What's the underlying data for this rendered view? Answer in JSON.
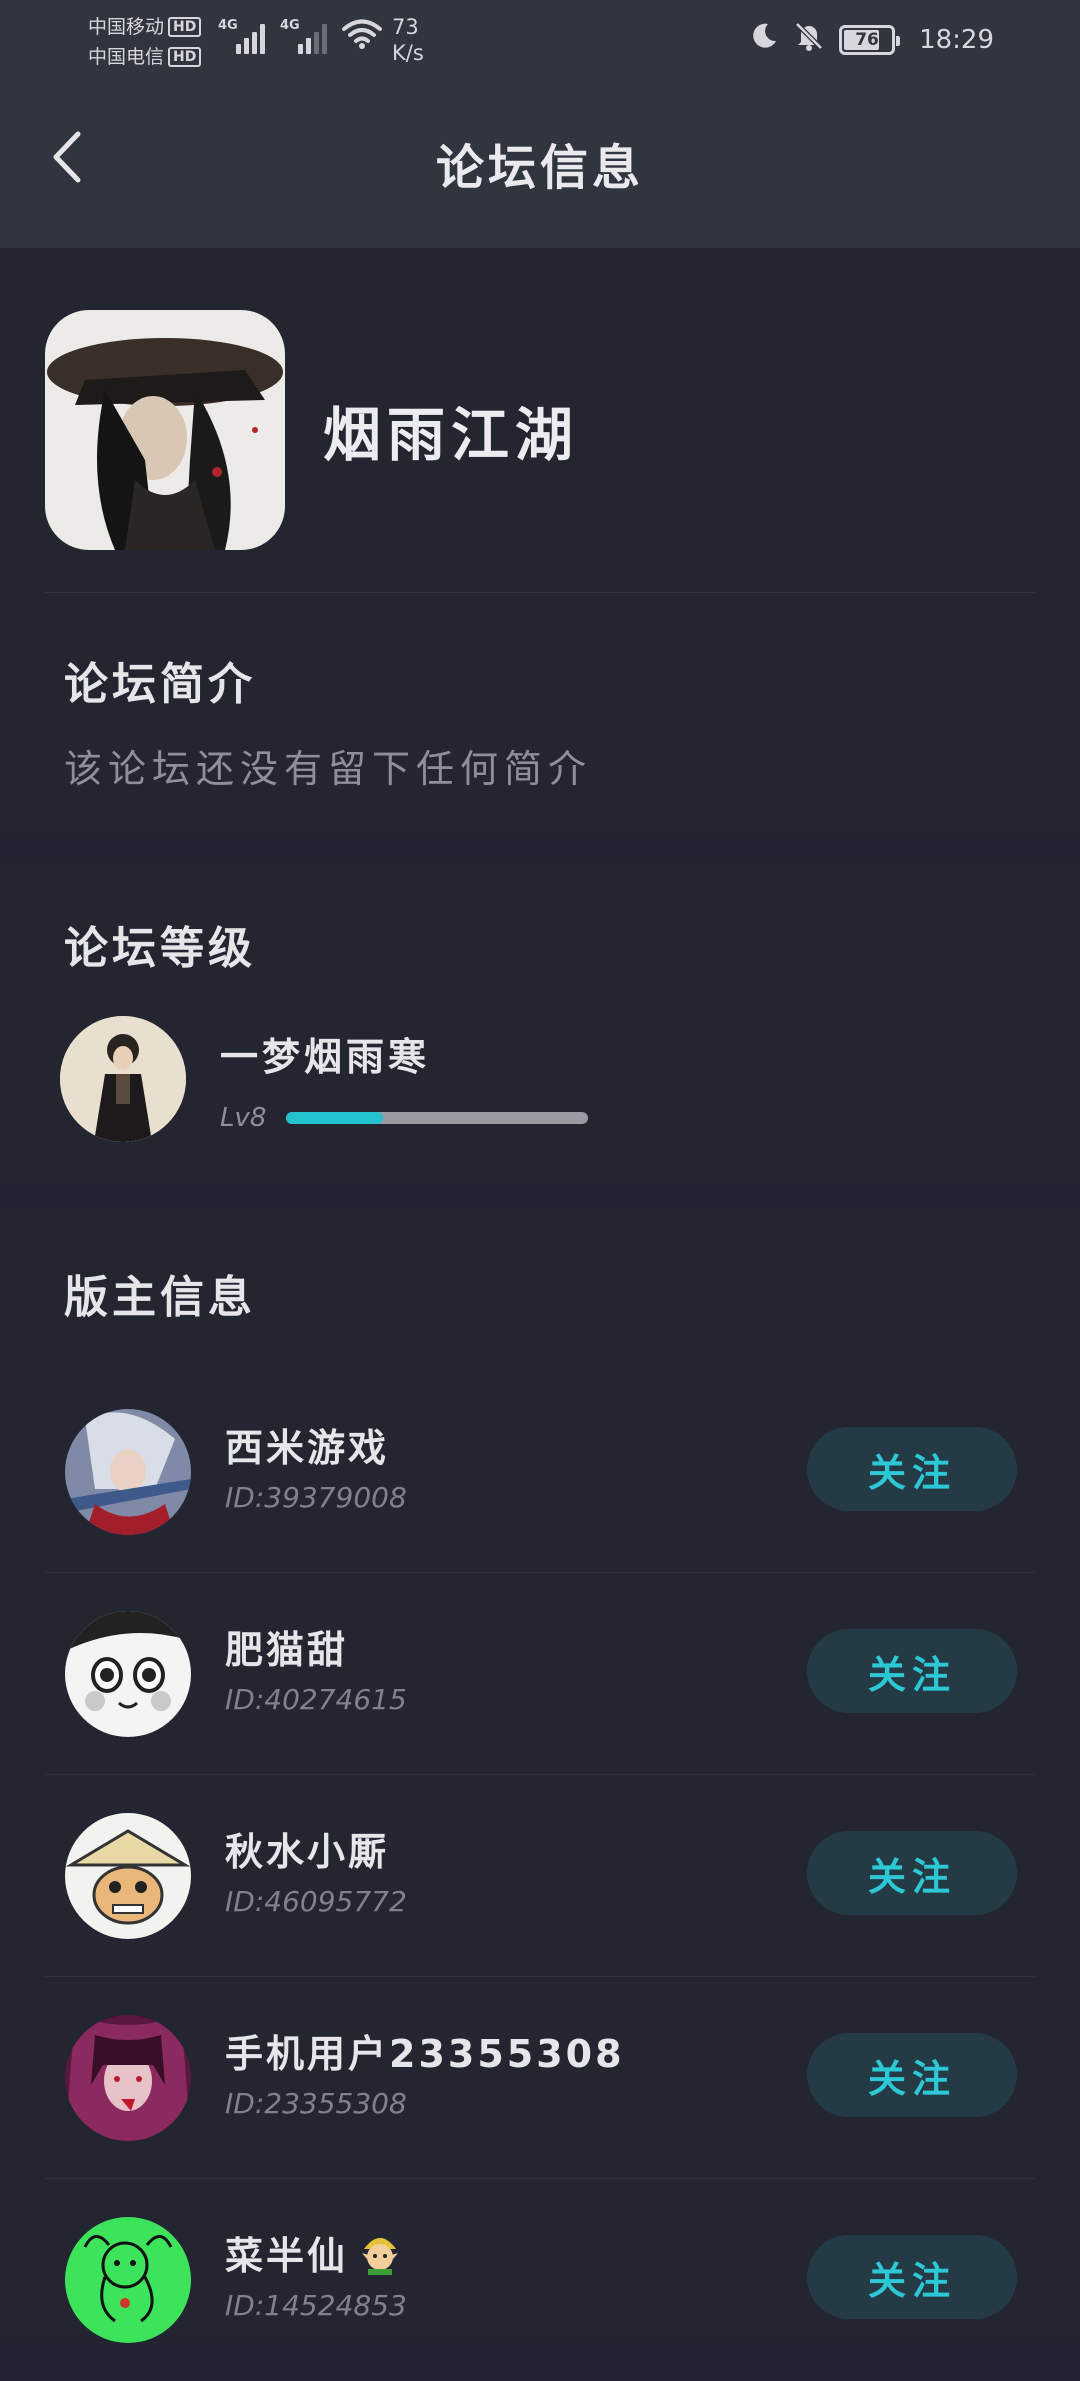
{
  "status_bar": {
    "carrier_1": "中国移动",
    "carrier_2": "中国电信",
    "hd": "HD",
    "network": "4G",
    "speed_value": "73",
    "speed_unit": "K/s",
    "battery": "76",
    "time": "18:29"
  },
  "nav": {
    "title": "论坛信息"
  },
  "forum": {
    "name": "烟雨江湖",
    "intro_title": "论坛简介",
    "intro_text": "该论坛还没有留下任何简介"
  },
  "level": {
    "title": "论坛等级",
    "user_name": "一梦烟雨寒",
    "level_label": "Lv8",
    "progress": 0.32,
    "accent": "#23c2cf"
  },
  "moderators": {
    "title": "版主信息",
    "follow_label": "关注",
    "items": [
      {
        "name": "西米游戏",
        "id": "ID:39379008"
      },
      {
        "name": "肥猫甜",
        "id": "ID:40274615"
      },
      {
        "name": "秋水小厮",
        "id": "ID:46095772"
      },
      {
        "name": "手机用户23355308",
        "id": "ID:23355308"
      },
      {
        "name": "菜半仙",
        "id": "ID:14524853"
      }
    ]
  }
}
